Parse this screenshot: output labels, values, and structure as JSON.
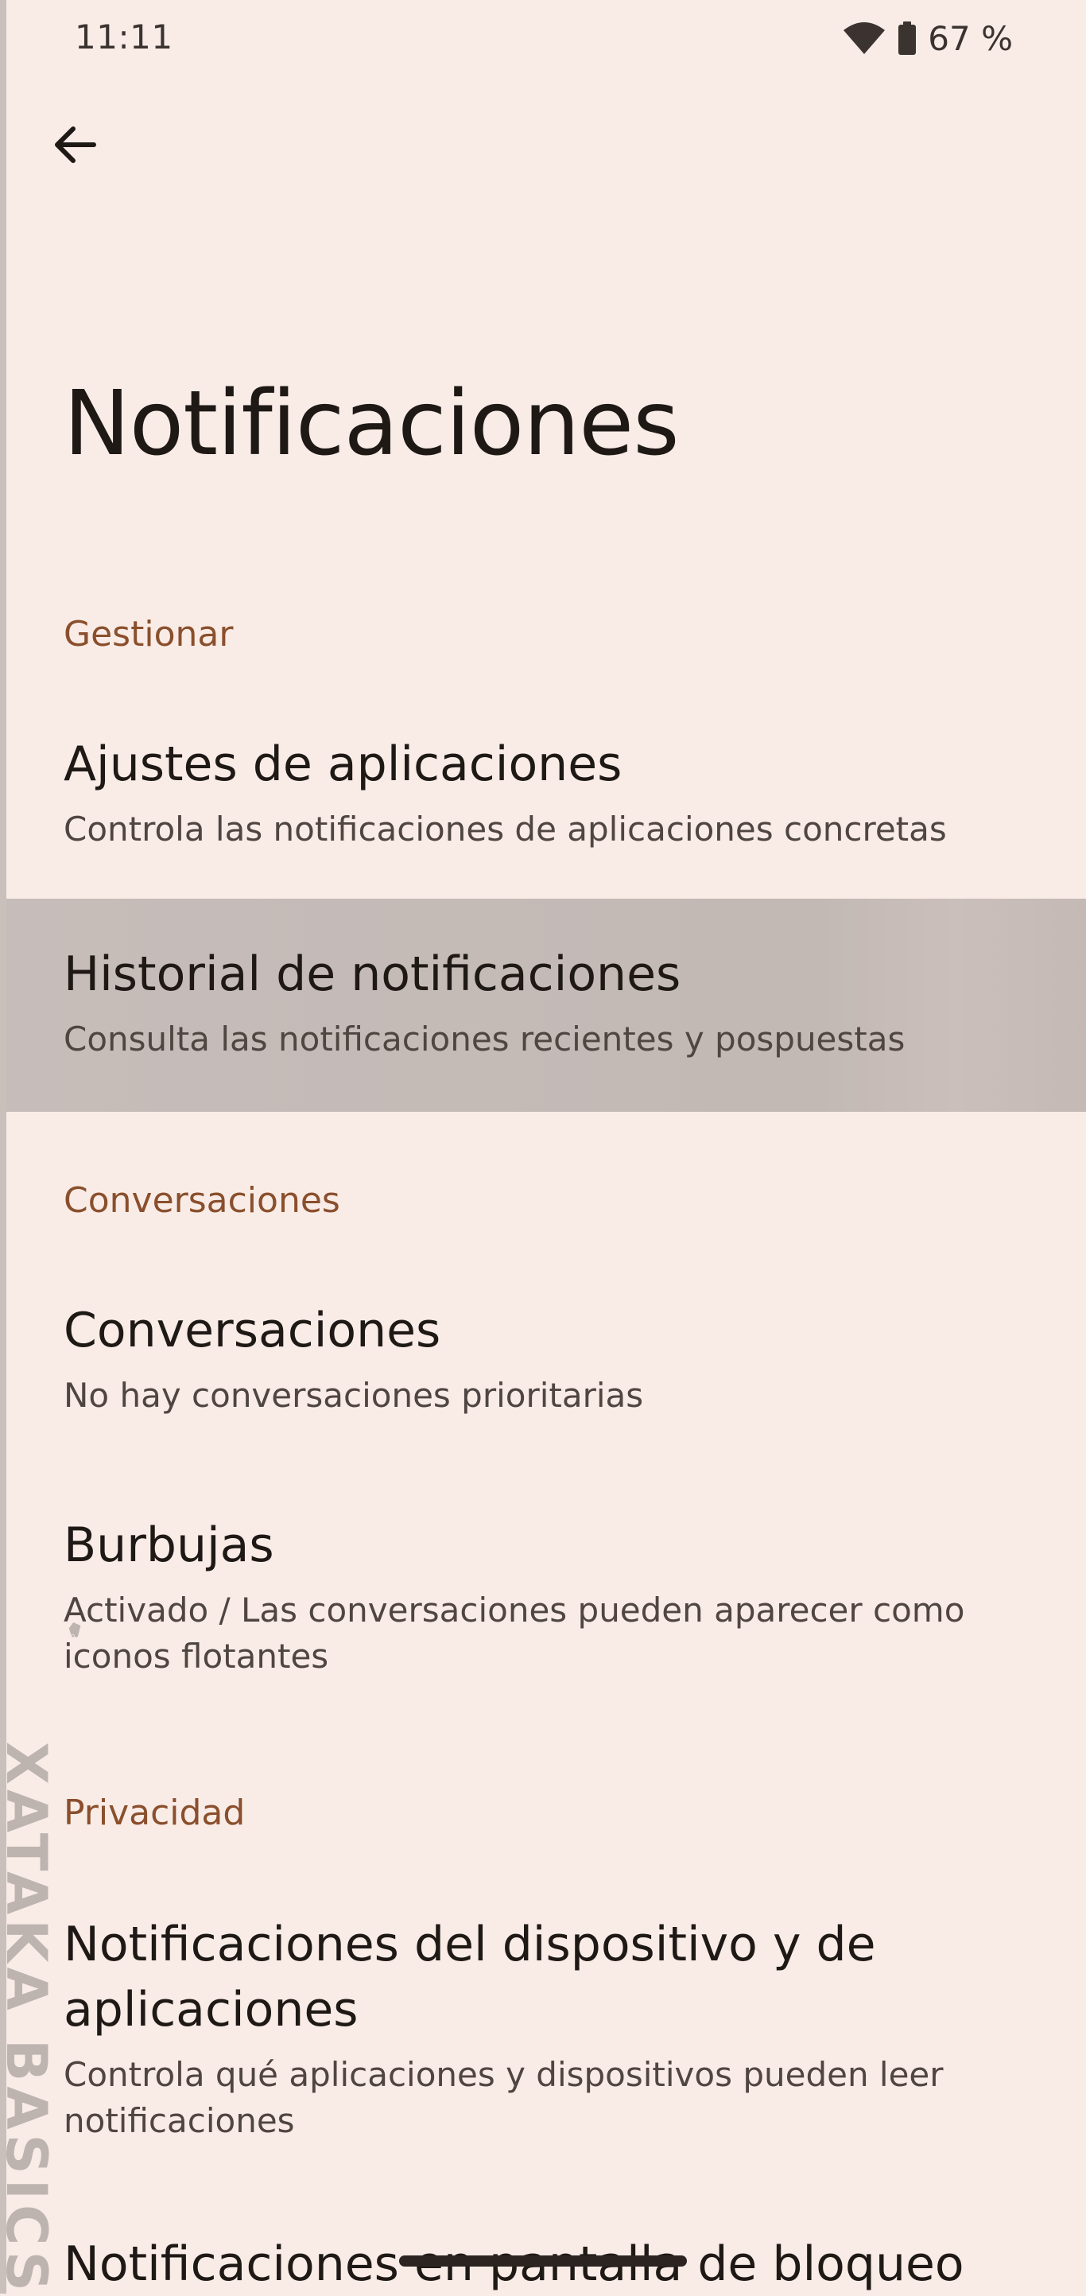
{
  "status_bar": {
    "time": "11:11",
    "battery": "67 %",
    "icons": [
      "wifi-icon",
      "battery-icon"
    ]
  },
  "header": {
    "back_icon": "arrow-left-icon",
    "title": "Notificaciones"
  },
  "sections": [
    {
      "header": "Gestionar",
      "items": [
        {
          "title": "Ajustes de aplicaciones",
          "subtitle": "Controla las notificaciones de aplicaciones concretas"
        },
        {
          "title": "Historial de notificaciones",
          "subtitle": "Consulta las notificaciones recientes y pospuestas"
        }
      ]
    },
    {
      "header": "Conversaciones",
      "items": [
        {
          "title": "Conversaciones",
          "subtitle": "No hay conversaciones prioritarias"
        },
        {
          "title": "Burbujas",
          "subtitle": "Activado / Las conversaciones pueden aparecer como iconos flotantes"
        }
      ]
    },
    {
      "header": "Privacidad",
      "items": [
        {
          "title": "Notificaciones del dispositivo y de aplicaciones",
          "subtitle": "Controla qué aplicaciones y dispositivos pueden leer notificaciones"
        },
        {
          "title": "Notificaciones en pantalla de bloqueo",
          "subtitle": ""
        }
      ]
    }
  ],
  "watermark": "XATAKA BASICS",
  "colors": {
    "background": "#f9ece7",
    "section_header": "#8a4f2c",
    "highlight": "#c4bab6"
  }
}
